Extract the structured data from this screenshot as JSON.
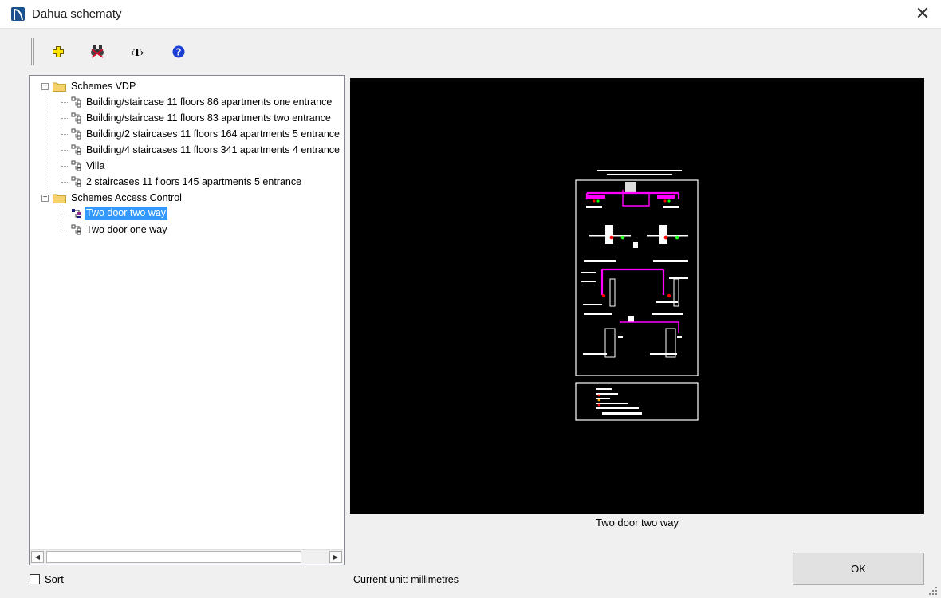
{
  "window": {
    "title": "Dahua schematy",
    "close_glyph": "✕"
  },
  "toolbar": {
    "buttons": [
      {
        "icon": "add-plus-icon"
      },
      {
        "icon": "binoculars-find-icon"
      },
      {
        "icon": "text-tool-icon",
        "glyph": "‹T›"
      },
      {
        "icon": "help-icon",
        "glyph": "?"
      }
    ]
  },
  "tree": {
    "groups": [
      {
        "label": "Schemes VDP",
        "expander": "−",
        "items": [
          {
            "label": "Building/staircase 11 floors 86 apartments one entrance"
          },
          {
            "label": "Building/staircase 11 floors 83 apartments two entrance"
          },
          {
            "label": "Building/2 staircases 11 floors 164 apartments 5 entrance"
          },
          {
            "label": "Building/4 staircases 11 floors 341 apartments 4 entrance"
          },
          {
            "label": "Villa"
          },
          {
            "label": "2 staircases 11 floors 145 apartments 5 entrance"
          }
        ]
      },
      {
        "label": "Schemes Access Control",
        "expander": "−",
        "items": [
          {
            "label": "Two door two way",
            "selected": true
          },
          {
            "label": "Two door one way"
          }
        ]
      }
    ],
    "scroll_left": "◀",
    "scroll_right": "▶"
  },
  "preview": {
    "caption": "Two door two way"
  },
  "sort": {
    "label": "Sort",
    "checked": false
  },
  "unit_text": "Current unit: millimetres",
  "ok_label": "OK",
  "colors": {
    "selection": "#3399ff",
    "preview_bg": "#000000",
    "wire_magenta": "#ff00ff"
  }
}
